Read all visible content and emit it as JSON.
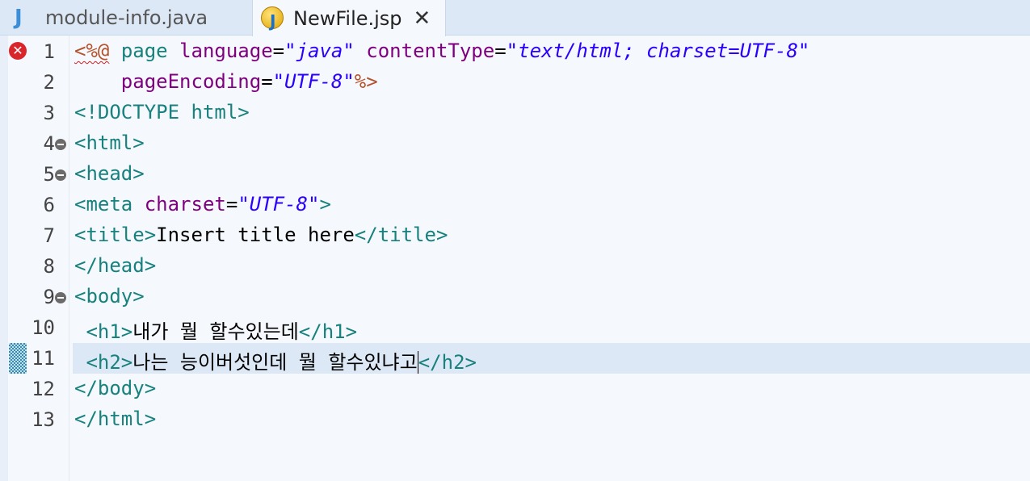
{
  "tabs": [
    {
      "icon": "java-file-icon",
      "label": "module-info.java",
      "active": false
    },
    {
      "icon": "jsp-file-icon",
      "label": "NewFile.jsp",
      "active": true,
      "close": "✕"
    }
  ],
  "editor": {
    "current_line": 11,
    "lines": [
      {
        "num": "1",
        "fold": false,
        "error": true,
        "segs": [
          [
            "d squig",
            "<%@"
          ],
          [
            "txt",
            " "
          ],
          [
            "t",
            "page"
          ],
          [
            "txt",
            " "
          ],
          [
            "a",
            "language"
          ],
          [
            "txt",
            "="
          ],
          [
            "v",
            "\"java\""
          ],
          [
            "txt",
            " "
          ],
          [
            "a",
            "contentType"
          ],
          [
            "txt",
            "="
          ],
          [
            "v",
            "\"text/html; charset=UTF-8\""
          ]
        ]
      },
      {
        "num": "2",
        "fold": false,
        "segs": [
          [
            "txt",
            "    "
          ],
          [
            "a",
            "pageEncoding"
          ],
          [
            "txt",
            "="
          ],
          [
            "v",
            "\"UTF-8\""
          ],
          [
            "d",
            "%>"
          ]
        ]
      },
      {
        "num": "3",
        "fold": false,
        "segs": [
          [
            "t",
            "<!DOCTYPE html>"
          ]
        ]
      },
      {
        "num": "4",
        "fold": true,
        "segs": [
          [
            "t",
            "<html>"
          ]
        ]
      },
      {
        "num": "5",
        "fold": true,
        "segs": [
          [
            "t",
            "<head>"
          ]
        ]
      },
      {
        "num": "6",
        "fold": false,
        "segs": [
          [
            "t",
            "<meta"
          ],
          [
            "txt",
            " "
          ],
          [
            "a",
            "charset"
          ],
          [
            "txt",
            "="
          ],
          [
            "v",
            "\"UTF-8\""
          ],
          [
            "t",
            ">"
          ]
        ]
      },
      {
        "num": "7",
        "fold": false,
        "segs": [
          [
            "t",
            "<title>"
          ],
          [
            "txt",
            "Insert title here"
          ],
          [
            "t",
            "</title>"
          ]
        ]
      },
      {
        "num": "8",
        "fold": false,
        "segs": [
          [
            "t",
            "</head>"
          ]
        ]
      },
      {
        "num": "9",
        "fold": true,
        "segs": [
          [
            "t",
            "<body>"
          ]
        ]
      },
      {
        "num": "10",
        "fold": false,
        "segs": [
          [
            "txt",
            " "
          ],
          [
            "t",
            "<h1>"
          ],
          [
            "txt",
            "내가 뭘 할수있는데"
          ],
          [
            "t",
            "</h1>"
          ]
        ]
      },
      {
        "num": "11",
        "fold": false,
        "current": true,
        "segs": [
          [
            "txt",
            " "
          ],
          [
            "t",
            "<h2>"
          ],
          [
            "txt",
            "나는 능이버섯인데 뭘 할수있냐고"
          ],
          [
            "t caret",
            "</h2>"
          ]
        ]
      },
      {
        "num": "12",
        "fold": false,
        "segs": [
          [
            "t",
            "</body>"
          ]
        ]
      },
      {
        "num": "13",
        "fold": false,
        "segs": [
          [
            "t",
            "</html>"
          ]
        ]
      }
    ]
  }
}
